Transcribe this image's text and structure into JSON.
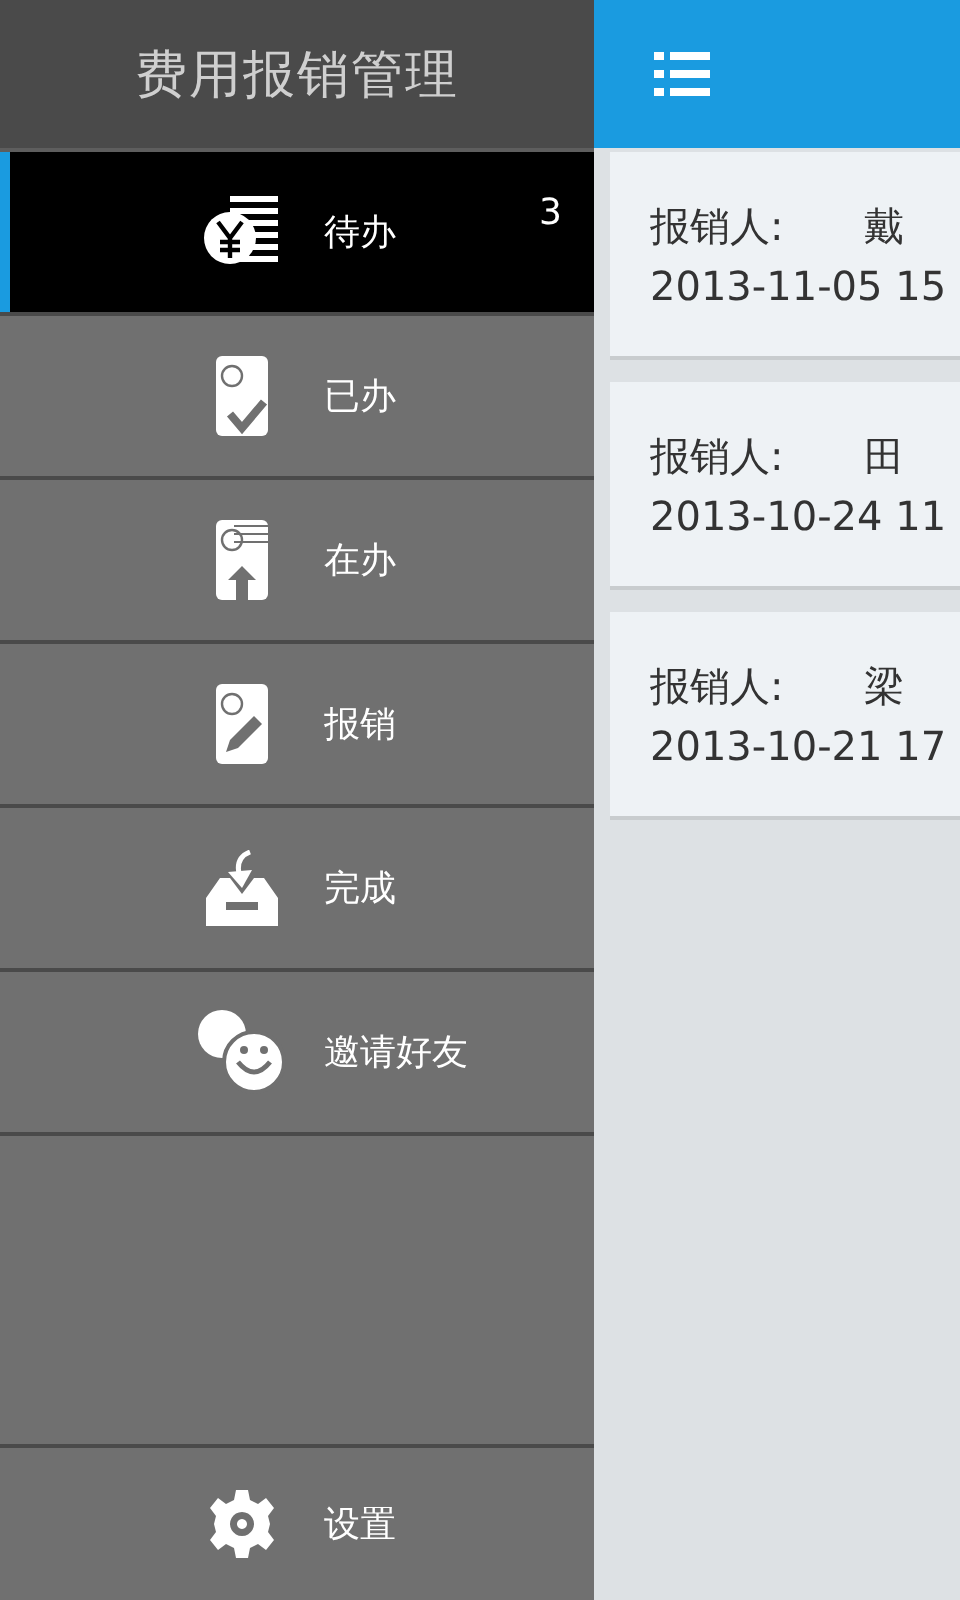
{
  "sidebar": {
    "title": "费用报销管理",
    "items": [
      {
        "label": "待办",
        "badge": "3",
        "selected": true
      },
      {
        "label": "已办",
        "selected": false
      },
      {
        "label": "在办",
        "selected": false
      },
      {
        "label": "报销",
        "selected": false
      },
      {
        "label": "完成",
        "selected": false
      },
      {
        "label": "邀请好友",
        "selected": false
      }
    ],
    "footer_item": {
      "label": "设置"
    }
  },
  "claims": [
    {
      "label": "报销人:",
      "name": "戴",
      "date": "2013-11-05 15"
    },
    {
      "label": "报销人:",
      "name": "田",
      "date": "2013-10-24 11"
    },
    {
      "label": "报销人:",
      "name": "梁",
      "date": "2013-10-21 17"
    }
  ]
}
